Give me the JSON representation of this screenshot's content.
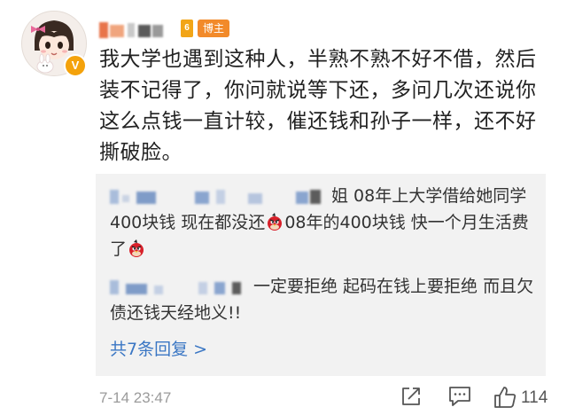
{
  "comment": {
    "author": {
      "role_tag": "博主",
      "level_badge": "6",
      "verified_badge": "V"
    },
    "text": "我大学也遇到这种人，半熟不熟不好不借，然后装不记得了，你问就说等下还，多问几次还说你这么点钱一直计较，催还钱和孙子一样，还不好撕破脸。",
    "timestamp": "7-14 23:47",
    "like_count": "114"
  },
  "replies": [
    {
      "segments": [
        "姐 08年上大学借给她同学400块钱 现在都没还",
        "08年的400块钱 快一个月生活费了"
      ]
    },
    {
      "segments": [
        "一定要拒绝 起码在钱上要拒绝 而且欠债还钱天经地义!!"
      ]
    }
  ],
  "more_replies_label": "共7条回复 >",
  "icons": {
    "share": "share-icon",
    "comment": "comment-icon",
    "like": "thumbs-up-icon",
    "emoji": "angry-bird-emoji-icon"
  },
  "colors": {
    "link": "#3b77c4",
    "reply_bg": "#f2f2f2",
    "role_tag": "#f28a2a",
    "verified": "#f4a20b"
  }
}
